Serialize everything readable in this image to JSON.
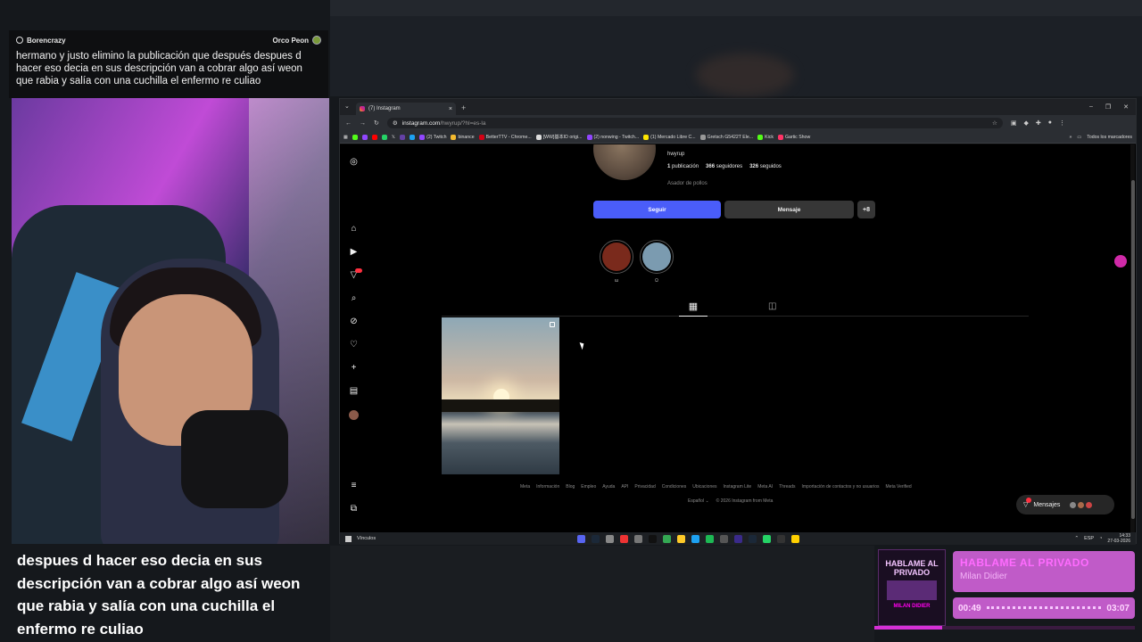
{
  "chat": {
    "username": "Borencrazy",
    "channel_name": "Orco Peon",
    "message": "hermano y justo elimino la publicación que después despues d hacer eso decia en sus descripción van a cobrar algo así weon que rabia y salía con una cuchilla el enfermo re culiao"
  },
  "subtitle": "despues d hacer eso decia en sus descripción van a cobrar algo así weon que rabia y salía con una cuchilla el enfermo re culiao",
  "music": {
    "album_title": "HABLAME AL PRIVADO",
    "album_sub": "MILAN DIDIER",
    "song_title": "HABLAME AL PRIVADO",
    "artist": "Milan Didier",
    "elapsed": "00:49",
    "duration": "03:07",
    "progress": 0.26
  },
  "browser": {
    "tab_title": "(7) Instagram",
    "url_host": "instagram.com",
    "url_path": "/hwyrup/?hl=es-la",
    "bookmarks": [
      {
        "label": "",
        "color": "#53fc18"
      },
      {
        "label": "",
        "color": "#9146ff"
      },
      {
        "label": "",
        "color": "#ff0000"
      },
      {
        "label": "",
        "color": "#25d366"
      },
      {
        "label": "𝕏",
        "color": ""
      },
      {
        "label": "",
        "color": "#6441a5"
      },
      {
        "label": "",
        "color": "#1da1f2"
      },
      {
        "label": "(2) Twitch",
        "color": "#9146ff"
      },
      {
        "label": "binance",
        "color": "#f3ba2f"
      },
      {
        "label": "BetterTTV - Chrome...",
        "color": "#d50014"
      },
      {
        "label": "[WW]基本ID origi...",
        "color": "#ddd"
      },
      {
        "label": "(2) nonwing - Twitch...",
        "color": "#9146ff"
      },
      {
        "label": "(1) Mercado Libre C...",
        "color": "#ffe600"
      },
      {
        "label": "Gretsch G5422T Ele...",
        "color": "#999"
      },
      {
        "label": "Kick",
        "color": "#53fc18"
      },
      {
        "label": "Gartic Show",
        "color": "#f36"
      }
    ],
    "all_bookmarks": "Todos los marcadores"
  },
  "profile": {
    "username": "hwyrup",
    "posts": "1",
    "posts_label": "publicación",
    "followers": "366",
    "followers_label": "seguidores",
    "following": "326",
    "following_label": "seguidos",
    "bio": "Asador de pollos",
    "follow_button": "Seguir",
    "message_button": "Mensaje",
    "add_button": "+8",
    "highlights": [
      {
        "label": "ɯ",
        "color": "#7a2a1c"
      },
      {
        "label": "Ω",
        "color": "#7b9bb0"
      }
    ],
    "notif_badge": "9+"
  },
  "footer": {
    "links": [
      "Meta",
      "Información",
      "Blog",
      "Empleo",
      "Ayuda",
      "API",
      "Privacidad",
      "Condiciones",
      "Ubicaciones",
      "Instagram Lite",
      "Meta AI",
      "Threads",
      "Importación de contactos y no usuarios",
      "Meta Verified"
    ],
    "language": "Español",
    "copyright": "© 2026 Instagram from Meta"
  },
  "messages_pill": {
    "label": "Mensajes",
    "badge": "7"
  },
  "taskbar": {
    "left_label": "Vínculos",
    "lang": "ESP",
    "time": "14:33",
    "date": "27-03-2026"
  },
  "colors": {
    "accent_instagram": "#4a5df9",
    "music_accent": "#c05bc8"
  }
}
